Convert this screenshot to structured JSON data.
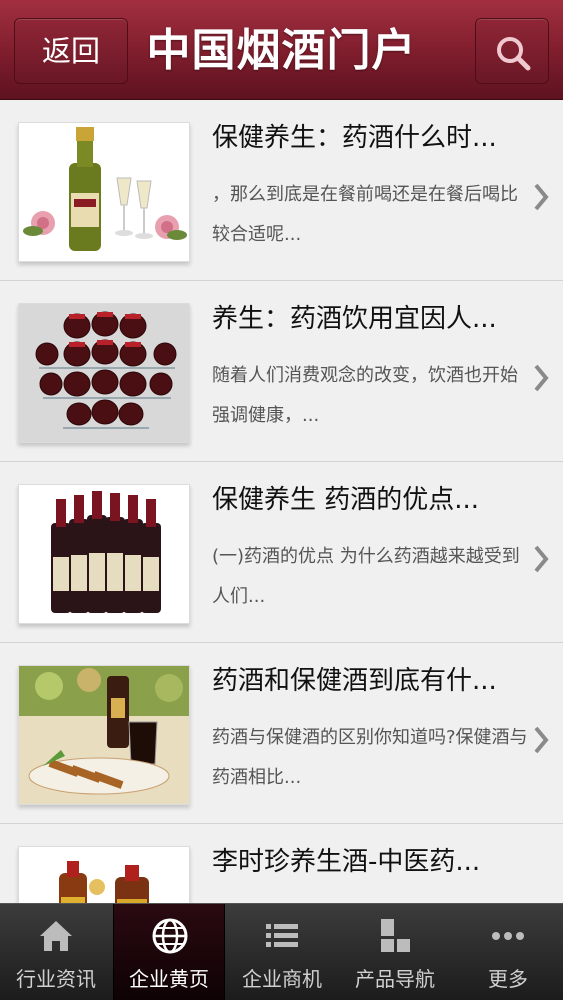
{
  "header": {
    "back_label": "返回",
    "title": "中国烟酒门户",
    "search_icon": "search-icon"
  },
  "articles": [
    {
      "title": "保健养生：药酒什么时...",
      "summary": "，那么到底是在餐前喝还是在餐后喝比较合适呢...",
      "thumbnail": "champagne-bottle-image"
    },
    {
      "title": "养生：药酒饮用宜因人...",
      "summary": "随着人们消费观念的改变，饮酒也开始强调健康，...",
      "thumbnail": "wine-jars-rack-image"
    },
    {
      "title": "保健养生 药酒的优点...",
      "summary": "(一)药酒的优点 为什么药酒越来越受到人们...",
      "thumbnail": "wine-bottles-image"
    },
    {
      "title": "药酒和保健酒到底有什...",
      "summary": "药酒与保健酒的区别你知道吗?保健酒与药酒相比...",
      "thumbnail": "beer-and-food-image"
    },
    {
      "title": "李时珍养生酒-中医药...",
      "summary": "",
      "thumbnail": "health-liquor-bottles-image"
    }
  ],
  "tabbar": {
    "active_index": 1,
    "tabs": [
      {
        "label": "行业资讯",
        "icon": "home-icon"
      },
      {
        "label": "企业黄页",
        "icon": "globe-icon"
      },
      {
        "label": "企业商机",
        "icon": "list-icon"
      },
      {
        "label": "产品导航",
        "icon": "grid-icon"
      },
      {
        "label": "更多",
        "icon": "more-icon"
      }
    ]
  },
  "colors": {
    "header": "#8b2232",
    "tabbar": "#262626",
    "tab_active": "#1a0508"
  }
}
